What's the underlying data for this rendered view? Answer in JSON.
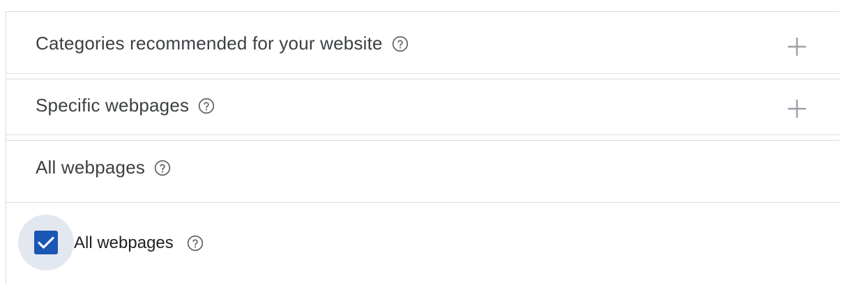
{
  "sections": [
    {
      "title": "Categories recommended for your website",
      "help_icon": "help-circle-icon",
      "expand_icon": "plus-icon"
    },
    {
      "title": "Specific webpages",
      "help_icon": "help-circle-icon",
      "expand_icon": "plus-icon"
    },
    {
      "title": "All webpages",
      "help_icon": "help-circle-icon"
    }
  ],
  "checkbox": {
    "label": "All webpages",
    "checked": true,
    "help_icon": "help-circle-icon"
  },
  "colors": {
    "checkbox_fill": "#1a56b3",
    "checkbox_halo": "#e3e7f0",
    "border": "#dadce0",
    "text": "#3c4043"
  }
}
